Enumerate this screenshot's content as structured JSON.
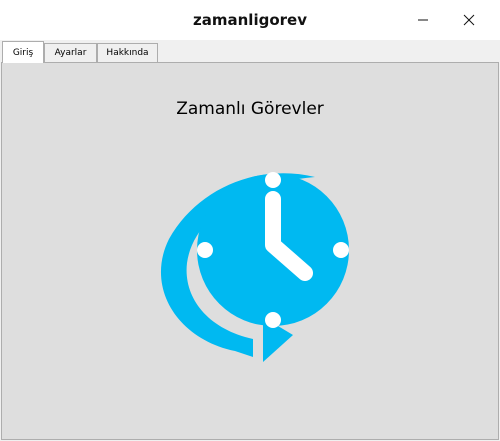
{
  "window": {
    "title": "zamanligorev"
  },
  "tabs": [
    {
      "label": "Giriş",
      "active": true
    },
    {
      "label": "Ayarlar",
      "active": false
    },
    {
      "label": "Hakkında",
      "active": false
    }
  ],
  "main": {
    "heading": "Zamanlı Görevler",
    "logo_icon": "scheduled-clock-icon",
    "accent_color": "#00b9f1"
  }
}
